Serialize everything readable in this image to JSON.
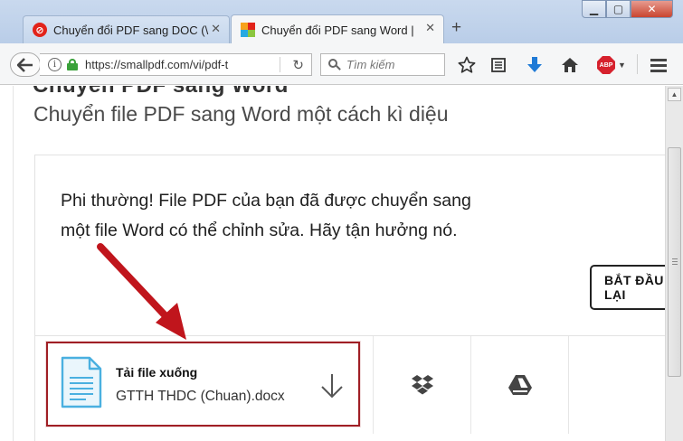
{
  "window": {
    "minimize_label": "▁",
    "maximize_label": "▢",
    "close_label": "✕"
  },
  "tabs": [
    {
      "title": "Chuyển đổi PDF sang DOC (\\",
      "favicon": "smallpdf-red-icon",
      "active": false
    },
    {
      "title": "Chuyển đổi PDF sang Word |",
      "favicon": "colorful-grid-icon",
      "active": true
    }
  ],
  "new_tab_label": "+",
  "toolbar": {
    "url": "https://smallpdf.com/vi/pdf-t",
    "search_placeholder": "Tìm kiếm",
    "abp_label": "ABP"
  },
  "page": {
    "heading_cut": "Chuyển PDF sang Word",
    "subtitle": "Chuyển file PDF sang Word một cách kì diệu",
    "message_line1": "Phi thường! File PDF của bạn đã được chuyển sang",
    "message_line2": "một file Word có thể chỉnh sửa. Hãy tận hưởng nó.",
    "start_button": "BẮT ĐẦU LẠI",
    "download": {
      "title": "Tải file xuống",
      "filename": "GTTH THDC (Chuan).docx"
    },
    "share_services": [
      "dropbox-icon",
      "google-drive-icon"
    ]
  },
  "colors": {
    "highlight_border": "#a01f25",
    "arrow": "#c0151c",
    "doc_icon": "#4ab0e0",
    "abp": "#d6212d"
  }
}
